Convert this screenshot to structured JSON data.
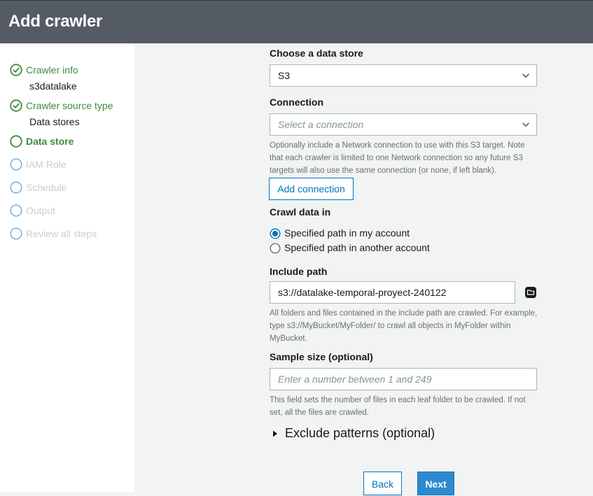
{
  "header": {
    "title": "Add crawler"
  },
  "sidebar": {
    "steps": [
      {
        "label": "Crawler info",
        "sub": "s3datalake",
        "state": "done"
      },
      {
        "label": "Crawler source type",
        "sub": "Data stores",
        "state": "done"
      },
      {
        "label": "Data store",
        "state": "current"
      },
      {
        "label": "IAM Role",
        "state": "todo"
      },
      {
        "label": "Schedule",
        "state": "todo"
      },
      {
        "label": "Output",
        "state": "todo"
      },
      {
        "label": "Review all steps",
        "state": "todo"
      }
    ]
  },
  "form": {
    "data_store": {
      "label": "Choose a data store",
      "value": "S3"
    },
    "connection": {
      "label": "Connection",
      "placeholder": "Select a connection",
      "help": "Optionally include a Network connection to use with this S3 target. Note that each crawler is limited to one Network connection so any future S3 targets will also use the same connection (or none, if left blank).",
      "add_button": "Add connection"
    },
    "crawl_data_in": {
      "label": "Crawl data in",
      "options": [
        {
          "label": "Specified path in my account",
          "selected": true
        },
        {
          "label": "Specified path in another account",
          "selected": false
        }
      ]
    },
    "include_path": {
      "label": "Include path",
      "value": "s3://datalake-temporal-proyect-240122",
      "help": "All folders and files contained in the include path are crawled. For example, type s3://MyBucket/MyFolder/ to crawl all objects in MyFolder within MyBucket."
    },
    "sample_size": {
      "label": "Sample size (optional)",
      "placeholder": "Enter a number between 1 and 249",
      "help": "This field sets the number of files in each leaf folder to be crawled. If not set, all the files are crawled."
    },
    "exclude_patterns": {
      "label": "Exclude patterns (optional)"
    }
  },
  "footer": {
    "back_label": "Back",
    "next_label": "Next"
  },
  "colors": {
    "header_bg": "#545b64",
    "done_green": "#3f8a3f",
    "disabled_gray": "#c9ced3",
    "link_blue": "#0073bb",
    "primary_blue": "#2b8ad0"
  },
  "icons": [
    "check-circle-icon",
    "circle-icon",
    "chevron-down-icon",
    "radio-icon",
    "folder-browse-icon",
    "caret-right-icon"
  ]
}
